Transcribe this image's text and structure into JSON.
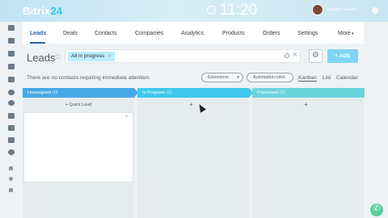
{
  "app": {
    "logo_text": "Bitrix",
    "logo_num": "24",
    "clock": "11:20",
    "user_name": "Stefan P. Graves"
  },
  "nav": {
    "tabs": [
      {
        "label": "Leads"
      },
      {
        "label": "Deals"
      },
      {
        "label": "Contacts"
      },
      {
        "label": "Companies"
      },
      {
        "label": "Analytics"
      },
      {
        "label": "Products"
      },
      {
        "label": "Orders"
      },
      {
        "label": "Settings"
      },
      {
        "label": "More"
      }
    ],
    "active_index": 0
  },
  "header": {
    "title": "Leads",
    "filter_chip": "All in progress",
    "add_label": "ADD"
  },
  "info_text": "There are no contacts requiring immediate attention.",
  "toolbar": {
    "extensions_label": "Extensions",
    "automation_label": "Automation rules",
    "views": [
      "Kanban",
      "List",
      "Calendar"
    ],
    "active_view": "Kanban"
  },
  "kanban": {
    "columns": [
      {
        "name": "Unassigned",
        "count": "(0)",
        "color": "#47a9e6"
      },
      {
        "name": "In Progress",
        "count": "(1)",
        "color": "#3ec8ee"
      },
      {
        "name": "Processed",
        "count": "(0)",
        "color": "#6ad4dd"
      }
    ],
    "quick_lead_label": "Quick Lead"
  },
  "colors": {
    "accent": "#2067b0",
    "add_button": "#7fd6f4",
    "chat": "#55d0a0"
  }
}
